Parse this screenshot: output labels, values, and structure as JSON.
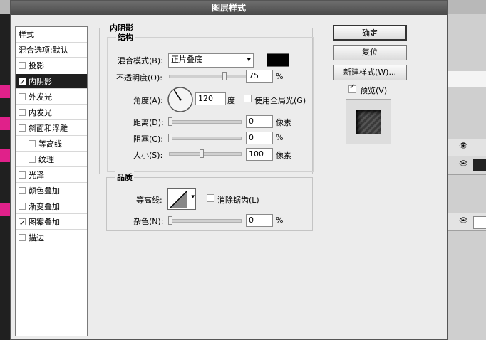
{
  "window": {
    "title": "图层样式"
  },
  "sidebar": {
    "header": "样式",
    "blend_item": "混合选项:默认",
    "items": [
      {
        "label": "投影",
        "checked": false
      },
      {
        "label": "内阴影",
        "checked": true
      },
      {
        "label": "外发光",
        "checked": false
      },
      {
        "label": "内发光",
        "checked": false
      },
      {
        "label": "斜面和浮雕",
        "checked": false
      },
      {
        "label": "等高线",
        "checked": false
      },
      {
        "label": "纹理",
        "checked": false
      },
      {
        "label": "光泽",
        "checked": false
      },
      {
        "label": "颜色叠加",
        "checked": false
      },
      {
        "label": "渐变叠加",
        "checked": false
      },
      {
        "label": "图案叠加",
        "checked": true
      },
      {
        "label": "描边",
        "checked": false
      }
    ]
  },
  "panel": {
    "title": "内阴影",
    "structure": {
      "title": "结构",
      "blend_mode_label": "混合模式(B):",
      "blend_mode_value": "正片叠底",
      "opacity_label": "不透明度(O):",
      "opacity_value": "75",
      "opacity_unit": "%",
      "angle_label": "角度(A):",
      "angle_value": "120",
      "angle_unit": "度",
      "global_light_label": "使用全局光(G)",
      "distance_label": "距离(D):",
      "distance_value": "0",
      "distance_unit": "像素",
      "choke_label": "阻塞(C):",
      "choke_value": "0",
      "choke_unit": "%",
      "size_label": "大小(S):",
      "size_value": "100",
      "size_unit": "像素"
    },
    "quality": {
      "title": "品质",
      "contour_label": "等高线:",
      "antialias_label": "消除锯齿(L)",
      "noise_label": "杂色(N):",
      "noise_value": "0",
      "noise_unit": "%"
    }
  },
  "buttons": {
    "ok": "确定",
    "reset": "复位",
    "new_style": "新建样式(W)...",
    "preview_label": "预览(V)"
  },
  "colors": {
    "shadow_color": "#000000"
  }
}
